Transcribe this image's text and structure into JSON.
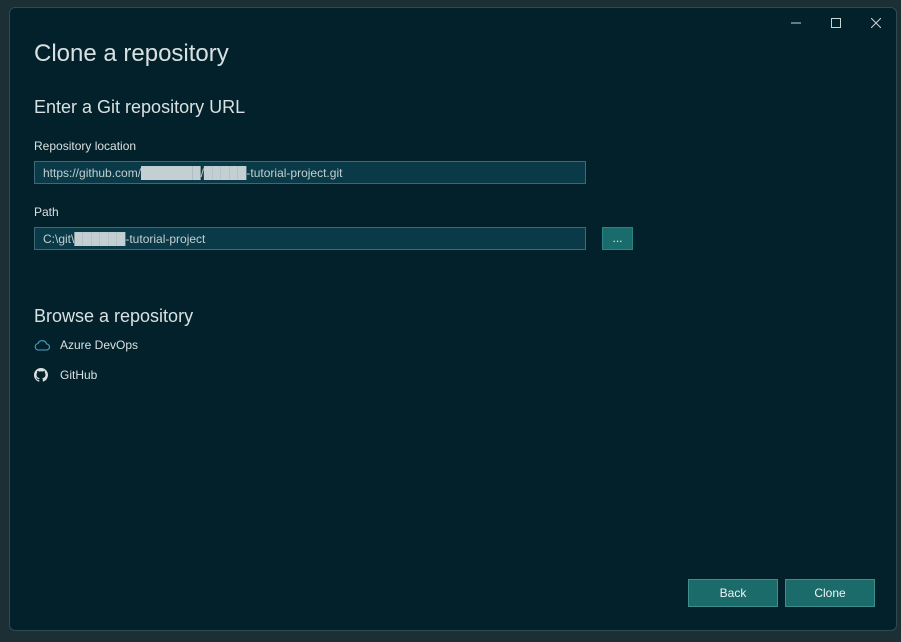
{
  "dialog": {
    "title": "Clone a repository",
    "url_section": {
      "heading": "Enter a Git repository URL",
      "repo_location_label": "Repository location",
      "repo_location_value": "https://github.com/███████/█████-tutorial-project.git",
      "path_label": "Path",
      "path_value": "C:\\git\\██████-tutorial-project",
      "browse_label": "..."
    },
    "browse_section": {
      "heading": "Browse a repository",
      "providers": [
        {
          "label": "Azure DevOps",
          "icon": "cloud-icon"
        },
        {
          "label": "GitHub",
          "icon": "github-icon"
        }
      ]
    },
    "buttons": {
      "back": "Back",
      "clone": "Clone"
    }
  },
  "colors": {
    "background": "#03212a",
    "input_bg": "#0a3a47",
    "accent": "#1b6b6b",
    "text": "#d9e0e2",
    "cloud_icon": "#4aa3c9"
  }
}
